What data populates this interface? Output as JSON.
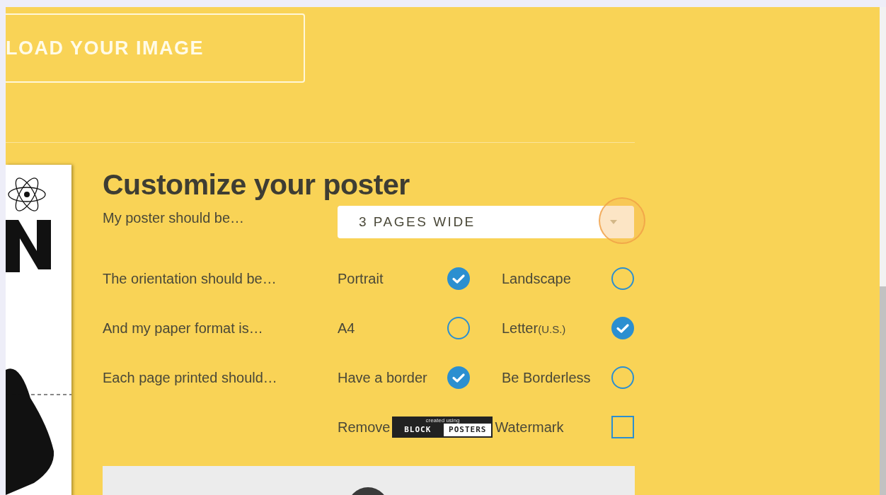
{
  "upload_button": {
    "label": "LOAD YOUR IMAGE"
  },
  "customize": {
    "title": "Customize your poster",
    "size": {
      "label": "My poster should be…",
      "value": "3 PAGES WIDE",
      "highlighted": true
    },
    "choices": [
      {
        "label": "The orientation should be…",
        "options": [
          {
            "label": "Portrait",
            "selected": true
          },
          {
            "label": "Landscape",
            "selected": false
          }
        ]
      },
      {
        "label": "And my paper format is…",
        "options": [
          {
            "label": "A4",
            "selected": false
          },
          {
            "label": "Letter",
            "note": "(U.S.)",
            "selected": true
          }
        ]
      },
      {
        "label": "Each page printed should…",
        "options": [
          {
            "label": "Have a border",
            "selected": true
          },
          {
            "label": "Be Borderless",
            "selected": false
          }
        ]
      }
    ],
    "watermark": {
      "before": "Remove",
      "logo": {
        "caption": "created using",
        "left": "BLOCK",
        "right": "POSTERS"
      },
      "after": "Watermark",
      "checked": false
    }
  }
}
